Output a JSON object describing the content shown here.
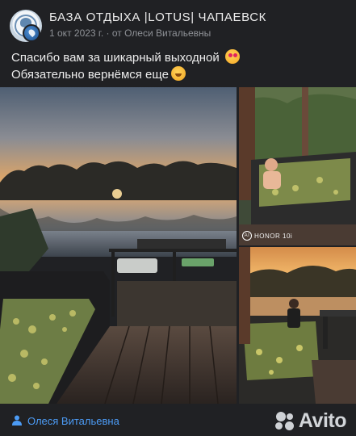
{
  "header": {
    "group_name": "БАЗА ОТДЫХА |LOTUS| ЧАПАЕВСК",
    "meta": "1 окт 2023 г. · от Олеси Витальевны"
  },
  "post": {
    "text_line_1": "Спасибо вам за шикарный выходной",
    "text_line_2": "Обязательно вернёмся еще",
    "emoji_1": "smiling-face-with-heart-eyes-emoji",
    "emoji_2": "hugging-face-emoji"
  },
  "photos": {
    "watermark_brand": "HONOR 10i",
    "watermark_logo": "AI"
  },
  "footer": {
    "author_name": "Олеся Витальевна",
    "brand": "Avito"
  },
  "colors": {
    "background": "#202124",
    "link": "#4c9bf5",
    "muted": "#8e9196"
  }
}
